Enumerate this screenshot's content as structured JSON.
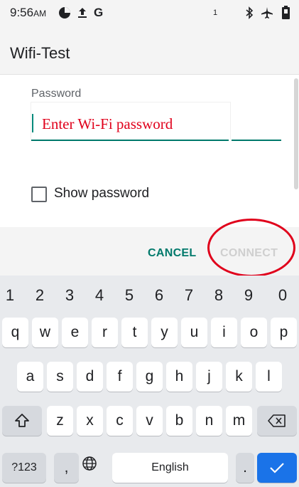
{
  "status_bar": {
    "time": "9:56",
    "ampm": "AM",
    "icons": [
      "data-saver-icon",
      "upload-icon",
      "google-icon",
      "sim-1-icon",
      "bluetooth-icon",
      "airplane-icon",
      "battery-icon"
    ],
    "g_letter": "G",
    "sim_label": "1"
  },
  "dialog": {
    "title": "Wifi-Test",
    "password_label": "Password",
    "password_placeholder": "Enter Wi-Fi password",
    "show_password_label": "Show password",
    "cancel_label": "CANCEL",
    "connect_label": "CONNECT"
  },
  "keyboard": {
    "numbers": [
      "1",
      "2",
      "3",
      "4",
      "5",
      "6",
      "7",
      "8",
      "9",
      "0"
    ],
    "row1": [
      "q",
      "w",
      "e",
      "r",
      "t",
      "y",
      "u",
      "i",
      "o",
      "p"
    ],
    "row2": [
      "a",
      "s",
      "d",
      "f",
      "g",
      "h",
      "j",
      "k",
      "l"
    ],
    "row3": [
      "z",
      "x",
      "c",
      "v",
      "b",
      "n",
      "m"
    ],
    "symbols_label": "?123",
    "comma_label": ",",
    "space_label": "English",
    "period_label": "."
  },
  "colors": {
    "accent": "#00796b",
    "annotation_red": "#e0001b",
    "enter_blue": "#1a73e8"
  }
}
